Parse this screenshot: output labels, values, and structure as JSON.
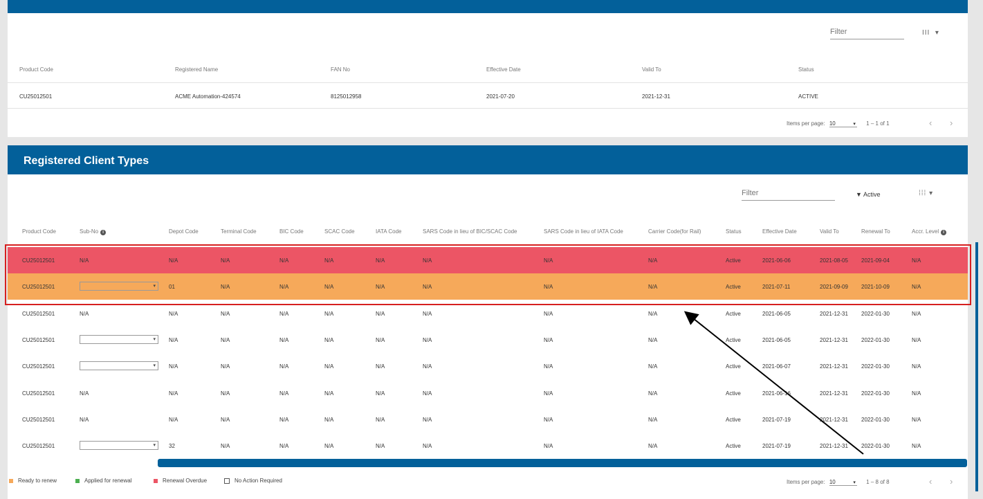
{
  "card1": {
    "filter_label": "Filter",
    "column_selector": "III",
    "column_selector_caret": "▾",
    "headers": [
      "Product Code",
      "Registered Name",
      "FAN No",
      "Effective Date",
      "Valid To",
      "Status"
    ],
    "row": [
      "CU25012501",
      "ACME Automation-424574",
      "8125012958",
      "2021-07-20",
      "2021-12-31",
      "ACTIVE"
    ],
    "pager": {
      "label": "Items per page:",
      "value": "10",
      "range": "1 – 1 of 1"
    }
  },
  "card2": {
    "title": "Registered Client Types",
    "filter_label": "Filter",
    "status_filter": "Active",
    "column_selector": "⁞⁞⁞",
    "column_selector_caret": "▾",
    "headers": [
      "Product Code",
      "Sub-No",
      "Depot Code",
      "Terminal Code",
      "BIC Code",
      "SCAC Code",
      "IATA Code",
      "SARS Code in lieu of BIC/SCAC Code",
      "SARS Code in lieu of IATA Code",
      "Carrier Code(for Rail)",
      "Status",
      "Effective Date",
      "Valid To",
      "Renewal To",
      "Accr. Level"
    ],
    "rows": [
      {
        "style": "red",
        "dropdown": false,
        "cells": [
          "CU25012501",
          "N/A",
          "N/A",
          "N/A",
          "N/A",
          "N/A",
          "N/A",
          "N/A",
          "N/A",
          "N/A",
          "Active",
          "2021-06-06",
          "2021-08-05",
          "2021-09-04",
          "N/A"
        ]
      },
      {
        "style": "orange",
        "dropdown": true,
        "cells": [
          "CU25012501",
          "",
          "01",
          "N/A",
          "N/A",
          "N/A",
          "N/A",
          "N/A",
          "N/A",
          "N/A",
          "Active",
          "2021-07-11",
          "2021-09-09",
          "2021-10-09",
          "N/A"
        ]
      },
      {
        "style": "plain",
        "dropdown": false,
        "cells": [
          "CU25012501",
          "N/A",
          "N/A",
          "N/A",
          "N/A",
          "N/A",
          "N/A",
          "N/A",
          "N/A",
          "N/A",
          "Active",
          "2021-06-05",
          "2021-12-31",
          "2022-01-30",
          "N/A"
        ]
      },
      {
        "style": "plain",
        "dropdown": true,
        "cells": [
          "CU25012501",
          "",
          "N/A",
          "N/A",
          "N/A",
          "N/A",
          "N/A",
          "N/A",
          "N/A",
          "N/A",
          "Active",
          "2021-06-05",
          "2021-12-31",
          "2022-01-30",
          "N/A"
        ]
      },
      {
        "style": "plain",
        "dropdown": true,
        "cells": [
          "CU25012501",
          "",
          "N/A",
          "N/A",
          "N/A",
          "N/A",
          "N/A",
          "N/A",
          "N/A",
          "N/A",
          "Active",
          "2021-06-07",
          "2021-12-31",
          "2022-01-30",
          "N/A"
        ]
      },
      {
        "style": "plain",
        "dropdown": false,
        "cells": [
          "CU25012501",
          "N/A",
          "N/A",
          "N/A",
          "N/A",
          "N/A",
          "N/A",
          "N/A",
          "N/A",
          "N/A",
          "Active",
          "2021-06-16",
          "2021-12-31",
          "2022-01-30",
          "N/A"
        ]
      },
      {
        "style": "plain",
        "dropdown": false,
        "cells": [
          "CU25012501",
          "N/A",
          "N/A",
          "N/A",
          "N/A",
          "N/A",
          "N/A",
          "N/A",
          "N/A",
          "N/A",
          "Active",
          "2021-07-19",
          "2021-12-31",
          "2022-01-30",
          "N/A"
        ]
      },
      {
        "style": "plain",
        "dropdown": true,
        "cells": [
          "CU25012501",
          "",
          "32",
          "N/A",
          "N/A",
          "N/A",
          "N/A",
          "N/A",
          "N/A",
          "N/A",
          "Active",
          "2021-07-19",
          "2021-12-31",
          "2022-01-30",
          "N/A"
        ]
      }
    ],
    "legend": [
      {
        "label": "Ready to renew",
        "color": "#f6a95a"
      },
      {
        "label": "Applied for renewal",
        "color": "#4caf50"
      },
      {
        "label": "Renewal Overdue",
        "color": "#ec5565"
      },
      {
        "label": "No Action Required",
        "color": "#ffffff"
      }
    ],
    "pager": {
      "label": "Items per page:",
      "value": "10",
      "range": "1 – 8 of 8"
    }
  },
  "icons": {
    "prev": "‹",
    "next": "›",
    "caret": "▾",
    "info": "i"
  },
  "colors": {
    "primary": "#03609a",
    "overdue": "#ec5565",
    "ready": "#f6a95a",
    "highlight_border": "#d62020"
  }
}
